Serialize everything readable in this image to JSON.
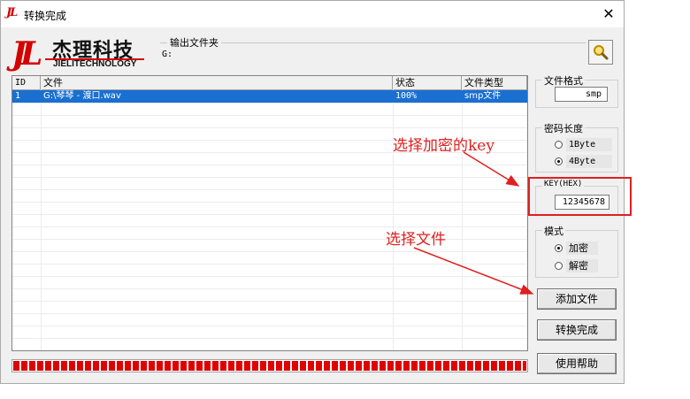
{
  "window": {
    "title": "转换完成",
    "close_glyph": "✕"
  },
  "logo": {
    "mark": "JL",
    "name_cn": "杰理科技",
    "name_en": "JIELITECHNOLOGY"
  },
  "output": {
    "label": "输出文件夹",
    "value": "G:"
  },
  "table": {
    "headers": [
      "ID",
      "文件",
      "状态",
      "文件类型"
    ],
    "rows": [
      {
        "id": "1",
        "file": "G:\\琴琴 - 渡口.wav",
        "status": "100%",
        "type": "smp文件"
      }
    ]
  },
  "progress": {
    "value": 1.0
  },
  "format": {
    "label": "文件格式",
    "value": "smp"
  },
  "key_length": {
    "label": "密码长度",
    "options": [
      "1Byte",
      "4Byte"
    ],
    "selected": "4Byte"
  },
  "key": {
    "label": "KEY(HEX)",
    "value": "12345678"
  },
  "mode": {
    "label": "模式",
    "options": [
      "加密",
      "解密"
    ],
    "selected": "加密"
  },
  "buttons": {
    "add_file": "添加文件",
    "convert_done": "转换完成",
    "help": "使用帮助"
  },
  "annotations": {
    "select_key": "选择加密的key",
    "select_file": "选择文件"
  },
  "colors": {
    "accent_red": "#e02020",
    "selection_blue": "#1a6fd1",
    "logo_red": "#d40000"
  }
}
